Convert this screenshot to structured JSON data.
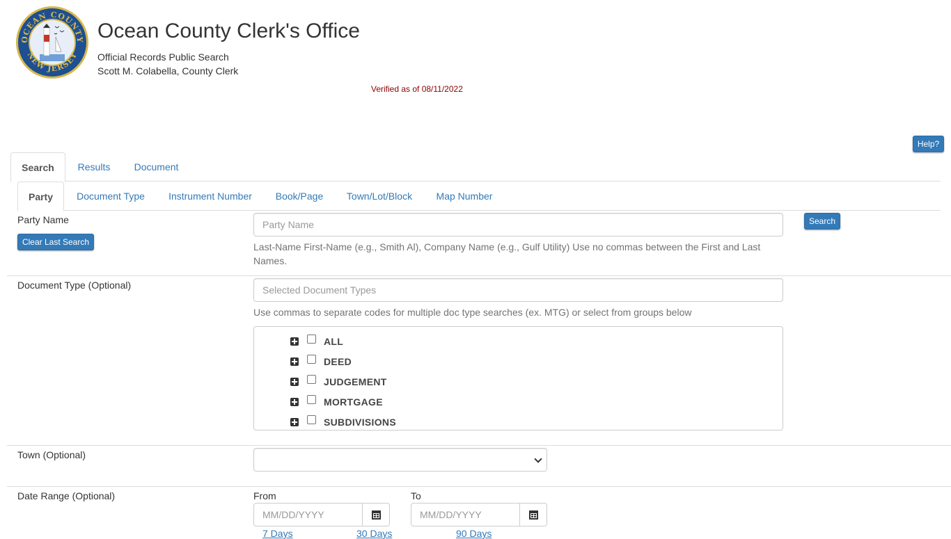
{
  "header": {
    "title": "Ocean County Clerk's Office",
    "subtitle1": "Official Records Public Search",
    "subtitle2": "Scott M. Colabella, County Clerk",
    "verified": "Verified as of 08/11/2022",
    "logo": {
      "top_text": "OCEAN COUNTY",
      "bottom_text": "NEW JERSEY"
    }
  },
  "help_button": "Help?",
  "main_tabs": [
    "Search",
    "Results",
    "Document"
  ],
  "sub_tabs": [
    "Party",
    "Document Type",
    "Instrument Number",
    "Book/Page",
    "Town/Lot/Block",
    "Map Number"
  ],
  "party": {
    "label": "Party Name",
    "placeholder": "Party Name",
    "clear_button": "Clear Last Search",
    "search_button": "Search",
    "help": "Last-Name First-Name (e.g., Smith Al), Company Name (e.g., Gulf Utility) Use no commas between the First and Last Names."
  },
  "doc_type": {
    "label": "Document Type (Optional)",
    "placeholder": "Selected Document Types",
    "help": "Use commas to separate codes for multiple doc type searches (ex. MTG) or select from groups below",
    "groups": [
      "ALL",
      "DEED",
      "JUDGEMENT",
      "MORTGAGE",
      "SUBDIVISIONS"
    ]
  },
  "town": {
    "label": "Town (Optional)",
    "value": ""
  },
  "date_range": {
    "label": "Date Range (Optional)",
    "from_label": "From",
    "to_label": "To",
    "from_placeholder": "MM/DD/YYYY",
    "to_placeholder": "MM/DD/YYYY",
    "quick_links": [
      "7 Days",
      "30 Days",
      "90 Days"
    ]
  },
  "colors": {
    "primary": "#337ab7",
    "verified": "#8b0000",
    "logo_blue": "#1d4f91",
    "logo_gold": "#d7b84b"
  }
}
